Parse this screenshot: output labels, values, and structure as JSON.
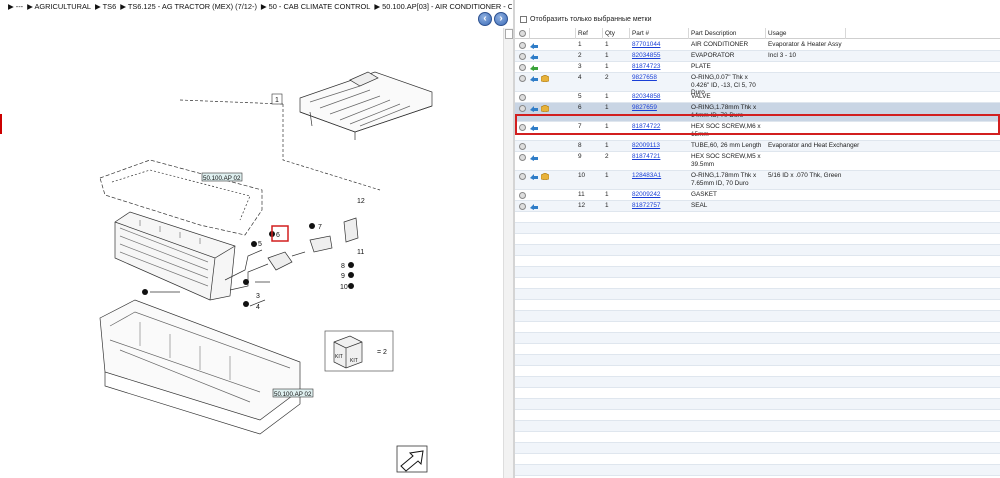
{
  "breadcrumb": {
    "items": [
      "---",
      "AGRICULTURAL",
      "TS6",
      "TS6.125 - AG TRACTOR (MEX) (7/12-)",
      "50 - CAB CLIMATE CONTROL",
      "50.100.AP[03] - AIR CONDITIONER - COMP..."
    ]
  },
  "diagram": {
    "callouts": [
      "1",
      "2",
      "3",
      "4",
      "5",
      "6",
      "7",
      "8",
      "9",
      "10",
      "11",
      "12"
    ],
    "ref_tags": [
      "50.100.AP 02",
      "50.100.AP 02"
    ],
    "kit_label": "KIT",
    "kit_eq": "= 2"
  },
  "filter": {
    "label": "Отобразить только выбранные метки"
  },
  "table": {
    "headers": {
      "ref": "Ref",
      "qty": "Qty",
      "part": "Part #",
      "desc": "Part Description",
      "usage": "Usage"
    },
    "rows": [
      {
        "ref": "1",
        "qty": "1",
        "part": "87701044",
        "desc": "AIR CONDITIONER",
        "usage": "Evaporator & Heater Assy",
        "arrow": "blue",
        "box": false,
        "lines": 1
      },
      {
        "ref": "2",
        "qty": "1",
        "part": "82034855",
        "desc": "EVAPORATOR",
        "usage": "Incl 3 - 10",
        "arrow": "blue",
        "box": false,
        "lines": 1
      },
      {
        "ref": "3",
        "qty": "1",
        "part": "81874723",
        "desc": "PLATE",
        "usage": "",
        "arrow": "green",
        "box": false,
        "lines": 1
      },
      {
        "ref": "4",
        "qty": "2",
        "part": "9827658",
        "desc": "O-RING,0.07\" Thk x 0.426\" ID, -13, Cl 5, 70 Duro",
        "usage": "",
        "arrow": "blue",
        "box": true,
        "lines": 2
      },
      {
        "ref": "5",
        "qty": "1",
        "part": "82034858",
        "desc": "VALVE",
        "usage": "",
        "arrow": "none",
        "box": false,
        "lines": 1
      },
      {
        "ref": "6",
        "qty": "1",
        "part": "9827659",
        "desc": "O-RING,1.78mm Thk x 14mm ID, 70 Duro",
        "usage": "",
        "arrow": "blue",
        "box": true,
        "lines": 2
      },
      {
        "ref": "7",
        "qty": "1",
        "part": "81874722",
        "desc": "HEX SOC SCREW,M6 x 15mm",
        "usage": "",
        "arrow": "blue",
        "box": false,
        "lines": 2
      },
      {
        "ref": "8",
        "qty": "1",
        "part": "82009113",
        "desc": "TUBE,60, 26 mm Length",
        "usage": "Evaporator and Heat Exchanger",
        "arrow": "none",
        "box": false,
        "lines": 1
      },
      {
        "ref": "9",
        "qty": "2",
        "part": "81874721",
        "desc": "HEX SOC SCREW,M5 x 39.5mm",
        "usage": "",
        "arrow": "blue",
        "box": false,
        "lines": 2
      },
      {
        "ref": "10",
        "qty": "1",
        "part": "128483A1",
        "desc": "O-RING,1.78mm Thk x 7.65mm ID, 70 Duro",
        "usage": "5/16 ID x .070 Thk, Green",
        "arrow": "blue",
        "box": true,
        "lines": 2
      },
      {
        "ref": "11",
        "qty": "1",
        "part": "82009242",
        "desc": "GASKET",
        "usage": "",
        "arrow": "none",
        "box": false,
        "lines": 1
      },
      {
        "ref": "12",
        "qty": "1",
        "part": "81872757",
        "desc": "SEAL",
        "usage": "",
        "arrow": "blue",
        "box": false,
        "lines": 1
      }
    ],
    "selected_ref": "6"
  }
}
